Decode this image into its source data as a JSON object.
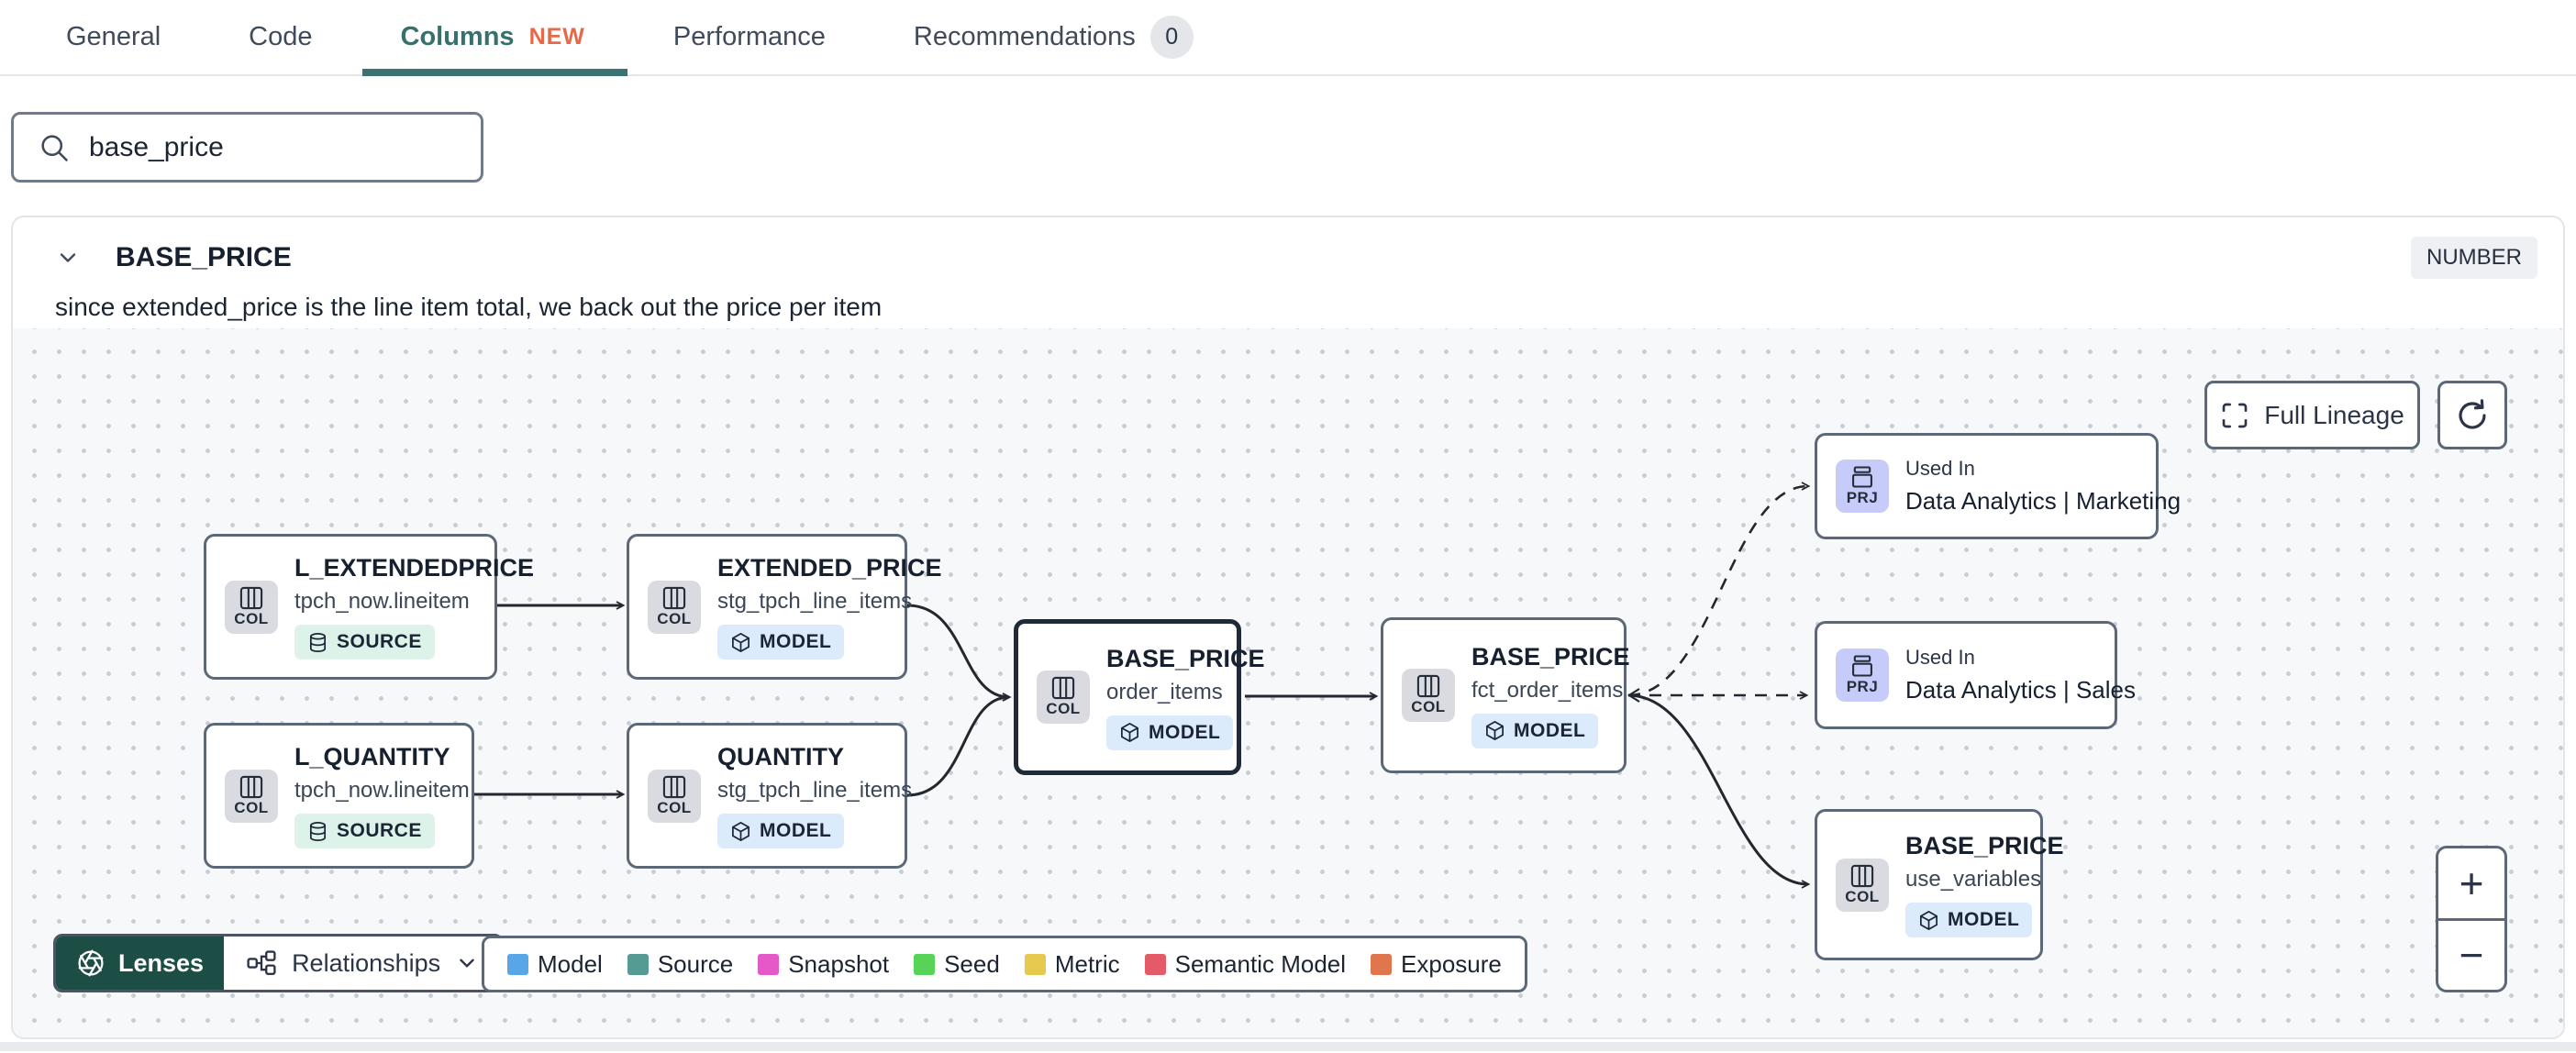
{
  "tabs": {
    "items": [
      {
        "label": "General"
      },
      {
        "label": "Code"
      },
      {
        "label": "Columns",
        "new_badge": "NEW"
      },
      {
        "label": "Performance"
      },
      {
        "label": "Recommendations",
        "count": "0"
      }
    ]
  },
  "search": {
    "value": "base_price"
  },
  "column_panel": {
    "name": "BASE_PRICE",
    "type": "NUMBER",
    "description": "since extended_price is the line item total, we back out the price per item"
  },
  "lineage": {
    "full_lineage_label": "Full Lineage",
    "lenses_label": "Lenses",
    "relationships_label": "Relationships",
    "zoom_in_label": "+",
    "zoom_out_label": "−",
    "nodes": [
      {
        "title": "L_EXTENDEDPRICE",
        "subtitle": "tpch_now.lineitem",
        "chip": "COL",
        "badge": "SOURCE"
      },
      {
        "title": "EXTENDED_PRICE",
        "subtitle": "stg_tpch_line_items",
        "chip": "COL",
        "badge": "MODEL"
      },
      {
        "title": "L_QUANTITY",
        "subtitle": "tpch_now.lineitem",
        "chip": "COL",
        "badge": "SOURCE"
      },
      {
        "title": "QUANTITY",
        "subtitle": "stg_tpch_line_items",
        "chip": "COL",
        "badge": "MODEL"
      },
      {
        "title": "BASE_PRICE",
        "subtitle": "order_items",
        "chip": "COL",
        "badge": "MODEL"
      },
      {
        "title": "BASE_PRICE",
        "subtitle": "fct_order_items",
        "chip": "COL",
        "badge": "MODEL"
      },
      {
        "eyebrow": "Used In",
        "title": "Data Analytics | Marketing",
        "chip": "PRJ"
      },
      {
        "eyebrow": "Used In",
        "title": "Data Analytics | Sales",
        "chip": "PRJ"
      },
      {
        "title": "BASE_PRICE",
        "subtitle": "use_variables",
        "chip": "COL",
        "badge": "MODEL"
      }
    ],
    "legend": {
      "items": [
        {
          "label": "Model",
          "color": "#58a6e8"
        },
        {
          "label": "Source",
          "color": "#569a94"
        },
        {
          "label": "Snapshot",
          "color": "#e458c8"
        },
        {
          "label": "Seed",
          "color": "#57d457"
        },
        {
          "label": "Metric",
          "color": "#e7c94f"
        },
        {
          "label": "Semantic Model",
          "color": "#e45a67"
        },
        {
          "label": "Exposure",
          "color": "#df764d"
        }
      ]
    }
  },
  "colors": {
    "active_tab": "#38706d",
    "new_badge": "#e8684a",
    "lenses_button": "#1d4e46"
  }
}
